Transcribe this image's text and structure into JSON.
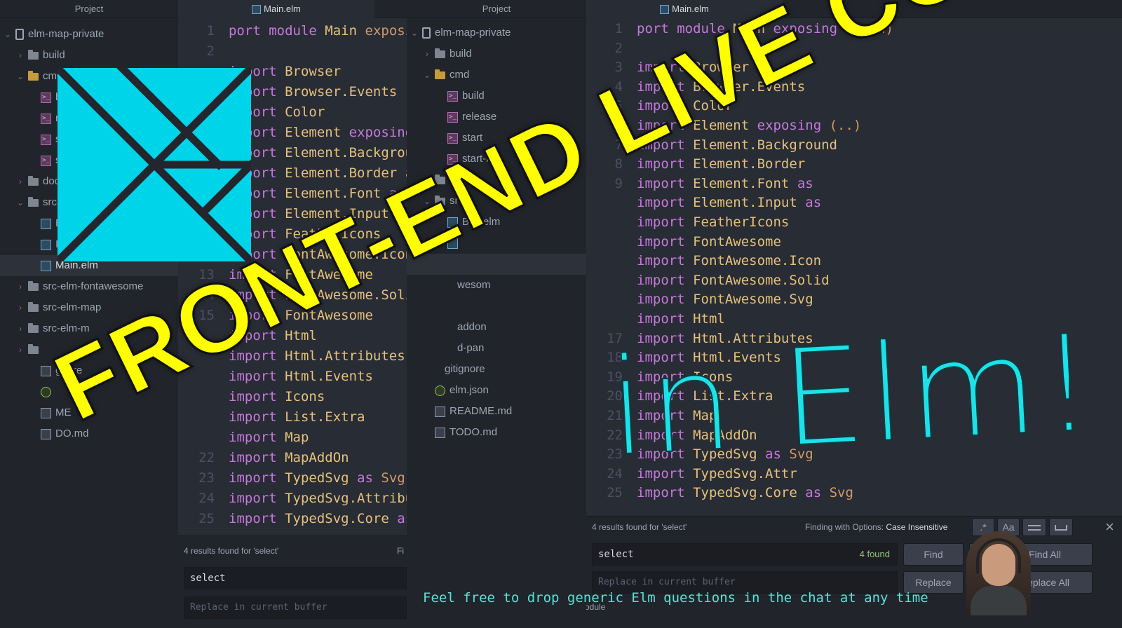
{
  "left_panel": {
    "header": "Project",
    "tab": "Main.elm",
    "tree": [
      {
        "label": "elm-map-private",
        "kind": "repo",
        "chev": "⌄"
      },
      {
        "label": "build",
        "kind": "folder",
        "chev": "›"
      },
      {
        "label": "cmd",
        "kind": "folder-open",
        "chev": "⌄"
      },
      {
        "label": "b",
        "kind": "term"
      },
      {
        "label": "r",
        "kind": "term"
      },
      {
        "label": "s",
        "kind": "term"
      },
      {
        "label": "s",
        "kind": "term"
      },
      {
        "label": "doc",
        "kind": "folder",
        "chev": "›"
      },
      {
        "label": "src",
        "kind": "folder",
        "chev": "⌄"
      },
      {
        "label": "B elm",
        "kind": "elm"
      },
      {
        "label": "Ico",
        "kind": "elm"
      },
      {
        "label": "Main.elm",
        "kind": "elm",
        "selected": true
      },
      {
        "label": "src-elm-fontawesome",
        "kind": "folder",
        "chev": "›"
      },
      {
        "label": "src-elm-map",
        "kind": "folder",
        "chev": "›"
      },
      {
        "label": "src-elm-m",
        "kind": "folder",
        "chev": "›"
      },
      {
        "label": "",
        "kind": "folder",
        "chev": "›"
      },
      {
        "label": "gnore",
        "kind": "file"
      },
      {
        "label": "",
        "kind": "json"
      },
      {
        "label": "ME",
        "kind": "md"
      },
      {
        "label": "DO.md",
        "kind": "md"
      }
    ],
    "line_numbers": [
      "1",
      "2",
      "",
      "",
      "",
      "",
      "",
      "",
      "",
      "10",
      "",
      "",
      "13",
      "14",
      "15",
      "",
      "",
      "",
      "",
      "",
      "",
      "22",
      "23",
      "24",
      "25"
    ],
    "code": [
      "port module Main exposi",
      "",
      "import Browser",
      "import Browser.Events",
      "import Color",
      "import Element exposing",
      "import Element.Backgrou",
      "import Element.Border a",
      "import Element.Font as",
      "import Element.Input as",
      "import FeatherIcons",
      "import FontAwesome.Icon",
      "import FontAwesome",
      "import FontAwesome.Solid",
      "import FontAwesome",
      "import Html",
      "import Html.Attributes",
      "import Html.Events",
      "import Icons",
      "import List.Extra",
      "import Map",
      "import MapAddOn",
      "import TypedSvg as Svg",
      "import TypedSvg.Attribu",
      "import TypedSvg.Core as"
    ],
    "find_results": "4 results found for 'select'",
    "find_trailing": "Fi",
    "find_value": "select",
    "replace_placeholder": "Replace in current buffer"
  },
  "middle_panel": {
    "header": "Project",
    "tree": [
      {
        "label": "elm-map-private",
        "kind": "repo",
        "chev": "⌄",
        "indent": 0
      },
      {
        "label": "build",
        "kind": "folder",
        "chev": "›",
        "indent": 1
      },
      {
        "label": "cmd",
        "kind": "folder-open",
        "chev": "⌄",
        "indent": 1
      },
      {
        "label": "build",
        "kind": "term",
        "indent": 2
      },
      {
        "label": "release",
        "kind": "term",
        "indent": 2
      },
      {
        "label": "start",
        "kind": "term",
        "indent": 2
      },
      {
        "label": "start-bus",
        "kind": "term",
        "indent": 2
      },
      {
        "label": "docs",
        "kind": "folder",
        "chev": "›",
        "indent": 1
      },
      {
        "label": "src",
        "kind": "folder",
        "chev": "⌄",
        "indent": 1
      },
      {
        "label": "Bus.elm",
        "kind": "elm",
        "indent": 2
      },
      {
        "label": "",
        "kind": "elm",
        "indent": 2
      },
      {
        "label": "",
        "kind": "none",
        "indent": 2,
        "selected": true
      },
      {
        "label": "wesom",
        "kind": "none",
        "indent": 3
      },
      {
        "label": "",
        "kind": "none",
        "indent": 3
      },
      {
        "label": "addon",
        "kind": "none",
        "indent": 3
      },
      {
        "label": "d-pan",
        "kind": "none",
        "indent": 3
      },
      {
        "label": "gitignore",
        "kind": "none",
        "indent": 2
      },
      {
        "label": "elm.json",
        "kind": "json",
        "indent": 1
      },
      {
        "label": "README.md",
        "kind": "md",
        "indent": 1
      },
      {
        "label": "TODO.md",
        "kind": "md",
        "indent": 1
      }
    ]
  },
  "right_panel": {
    "tab": "Main.elm",
    "line_numbers": [
      "1",
      "2",
      "3",
      "4",
      "5",
      "6",
      "7",
      "8",
      "9",
      "",
      "",
      "",
      "",
      "",
      "",
      "",
      "17",
      "18",
      "19",
      "20",
      "21",
      "22",
      "23",
      "24",
      "25"
    ],
    "code": [
      "port module Main exposing (main)",
      "",
      "import Browser",
      "import Browser.Events",
      "import Color",
      "import Element exposing (..)",
      "import Element.Background",
      "import Element.Border",
      "import Element.Font as",
      "import Element.Input as",
      "import FeatherIcons",
      "import FontAwesome",
      "import FontAwesome.Icon",
      "import FontAwesome.Solid",
      "import FontAwesome.Svg",
      "import Html",
      "import Html.Attributes",
      "import Html.Events",
      "import Icons",
      "import List.Extra",
      "import Map",
      "import MapAddOn",
      "import TypedSvg as Svg",
      "import TypedSvg.Attr",
      "import TypedSvg.Core as Svg"
    ],
    "find_results": "4 results found for 'select'",
    "find_options_label": "Finding with Options:",
    "find_options_value": "Case Insensitive",
    "opt_regex": ".*",
    "opt_case": "Aa",
    "find_value": "select",
    "found_count": "4 found",
    "find_button": "Find",
    "find_all_button": "Find All",
    "replace_placeholder": "Replace in current buffer",
    "replace_button": "Replace",
    "replace_all_button": "Replace All",
    "close": "×",
    "status_word": "module"
  },
  "overlay": {
    "headline": "FRONT-END LIVE CODING",
    "subhead": "in Elm!",
    "caption": "Feel free to drop generic Elm questions in the chat at any time"
  },
  "colors": {
    "headline": "#ffff00",
    "subhead": "#1ee0e8",
    "logo": "#00d4e8",
    "caption": "#5ce0d6"
  },
  "icons": {
    "logo": "elm-tangram-logo",
    "webcam": "webcam-person"
  }
}
